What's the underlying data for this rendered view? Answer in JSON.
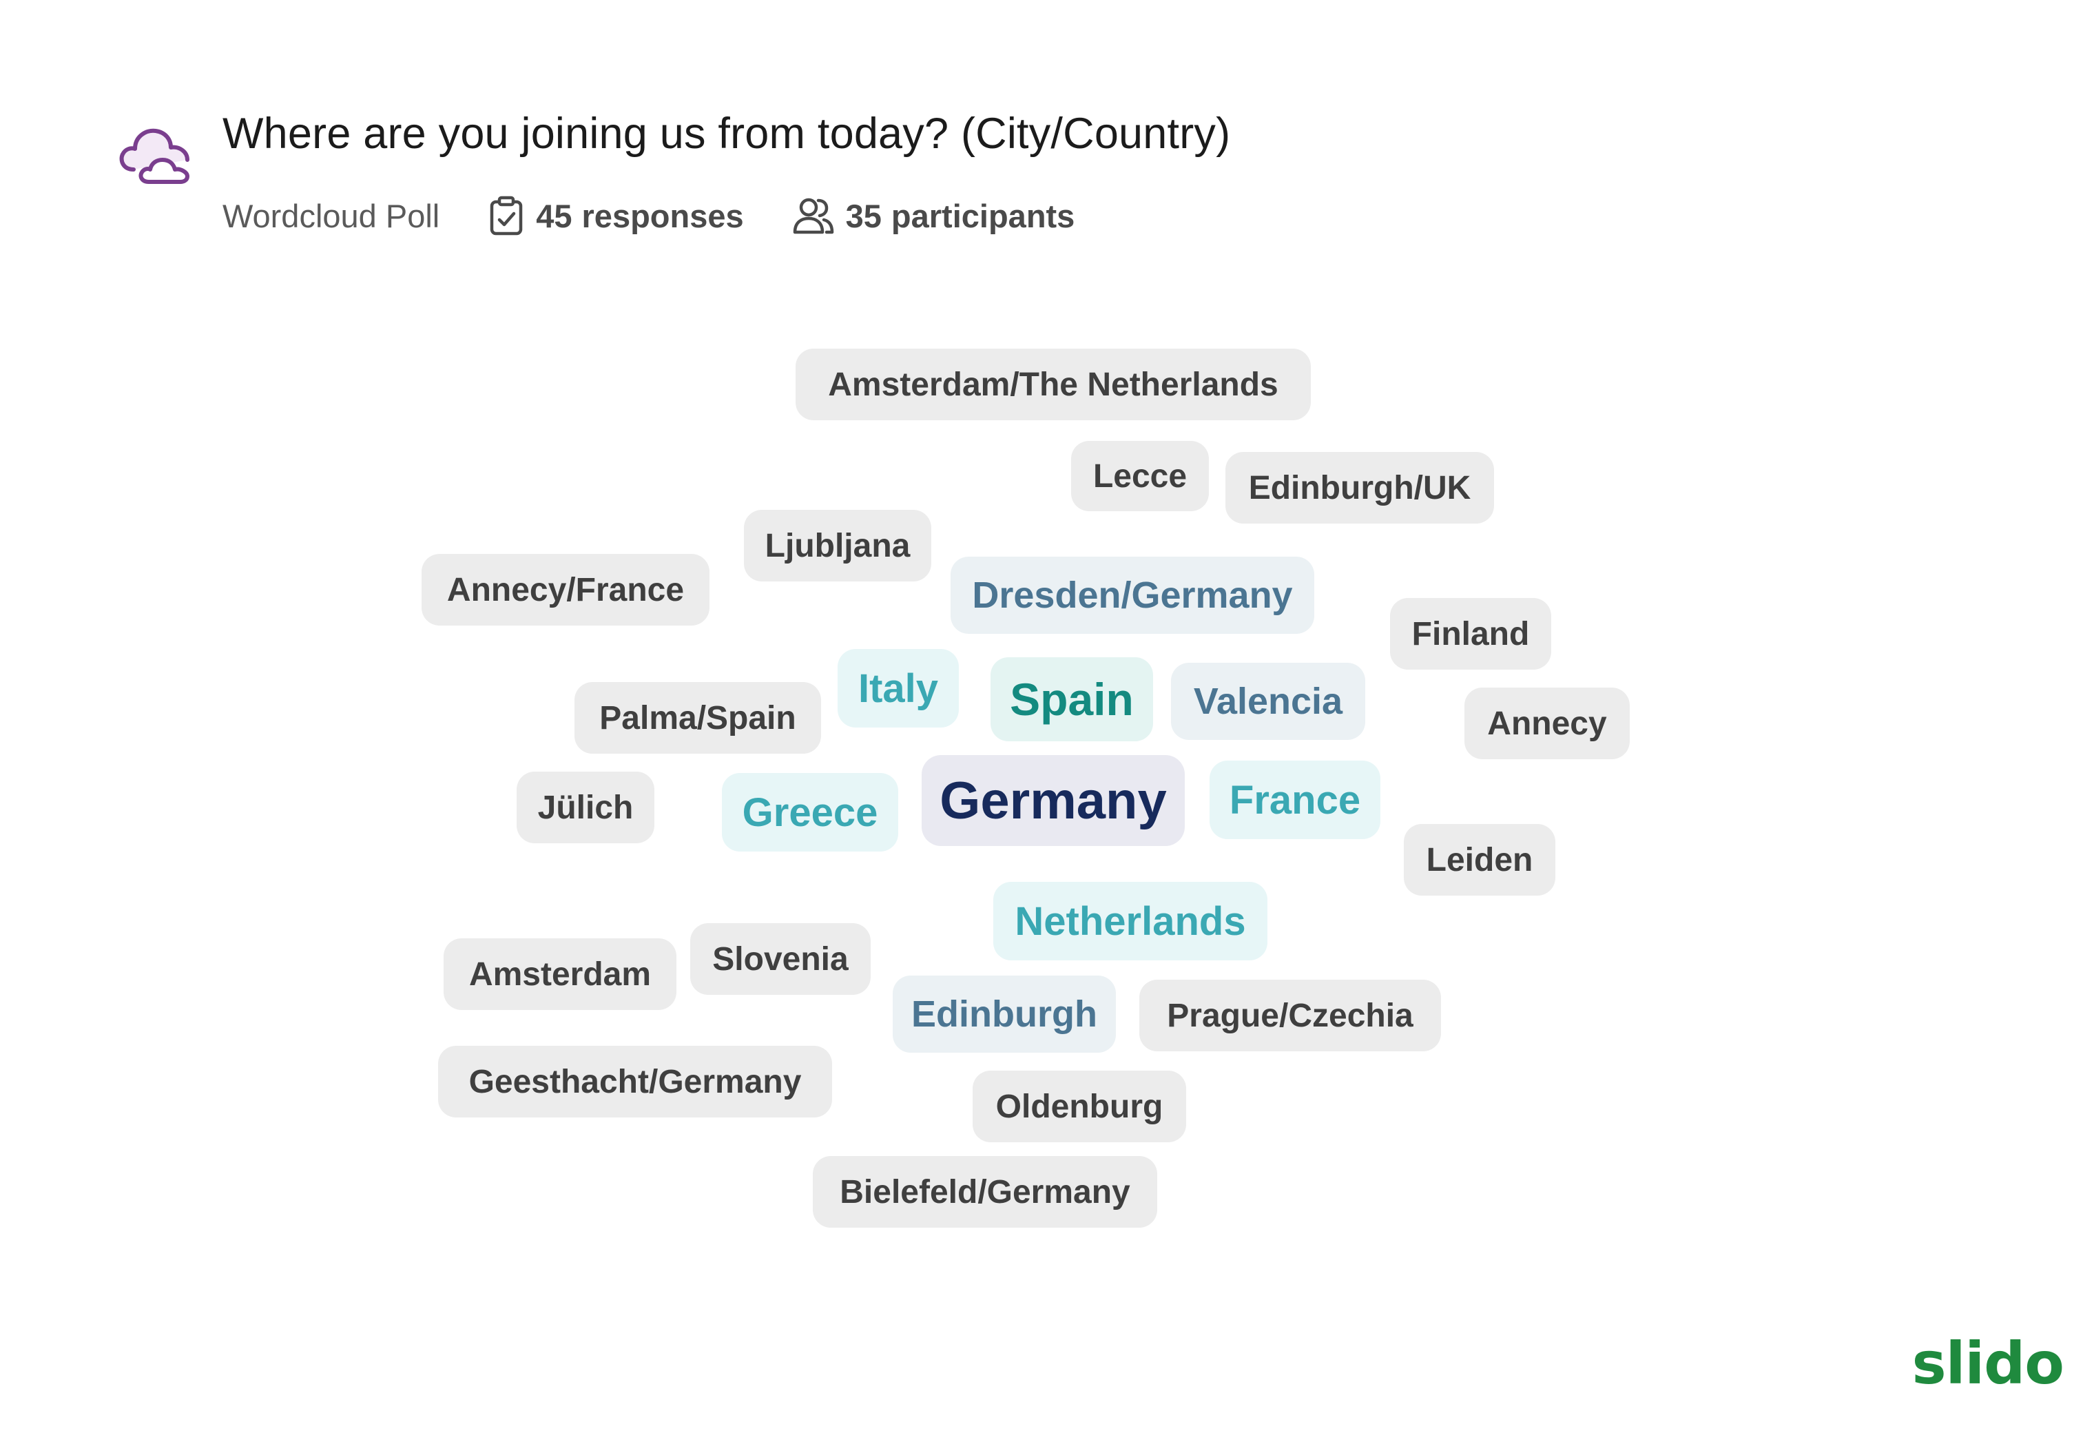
{
  "poll": {
    "icon": "cloud-poll-icon",
    "title": "Where are you joining us from today? (City/Country)",
    "type_label": "Wordcloud Poll",
    "responses_count": "45",
    "responses_label": "responses",
    "participants_count": "35",
    "participants_label": "participants"
  },
  "words": [
    "Amsterdam/The Netherlands",
    "Lecce",
    "Edinburgh/UK",
    "Ljubljana",
    "Annecy/France",
    "Dresden/Germany",
    "Finland",
    "Italy",
    "Spain",
    "Valencia",
    "Palma/Spain",
    "Annecy",
    "Jülich",
    "Greece",
    "Germany",
    "France",
    "Leiden",
    "Netherlands",
    "Amsterdam",
    "Slovenia",
    "Edinburgh",
    "Prague/Czechia",
    "Geesthacht/Germany",
    "Oldenburg",
    "Bielefeld/Germany"
  ],
  "brand": "slido",
  "colors": {
    "icon_purple": "#7a3e8e",
    "brand_green": "#1f8a3e",
    "top_word": "#172a5c",
    "second_word": "#148a80",
    "teal_word": "#3aa8b3",
    "slate_word": "#4b7592",
    "default_word": "#3f3f3f"
  }
}
